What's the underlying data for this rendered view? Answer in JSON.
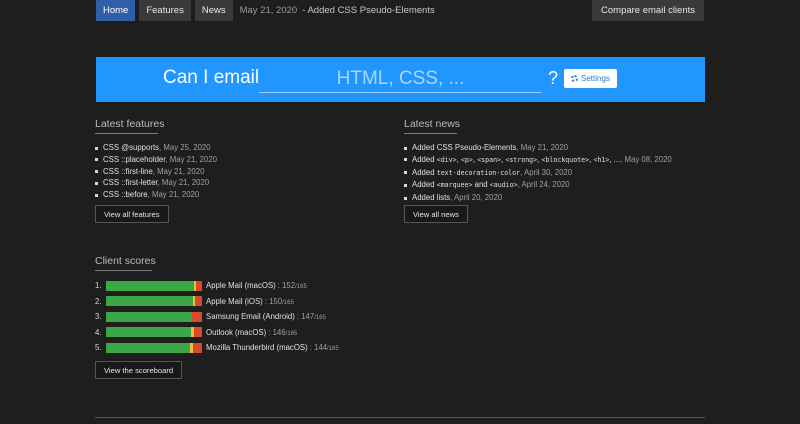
{
  "nav": {
    "home": "Home",
    "features": "Features",
    "news": "News",
    "latest_date": "May 21, 2020",
    "latest_text": "- Added CSS Pseudo-Elements",
    "compare": "Compare email clients"
  },
  "hero": {
    "label": "Can I email",
    "placeholder": "HTML, CSS, ...",
    "question": "?",
    "settings": "Settings"
  },
  "features": {
    "title": "Latest features",
    "items": [
      {
        "name": "CSS @supports",
        "date": ", May 25, 2020"
      },
      {
        "name": "CSS ::placeholder",
        "date": ", May 21, 2020"
      },
      {
        "name": "CSS ::first-line",
        "date": ", May 21, 2020"
      },
      {
        "name": "CSS ::first-letter",
        "date": ", May 21, 2020"
      },
      {
        "name": "CSS ::before",
        "date": ", May 21, 2020"
      }
    ],
    "button": "View all features"
  },
  "news": {
    "title": "Latest news",
    "items": [
      {
        "parts": [
          {
            "t": "Added CSS Pseudo-Elements"
          }
        ],
        "date": ", May 21, 2020"
      },
      {
        "parts": [
          {
            "t": "Added "
          },
          {
            "t": "<div>",
            "code": true
          },
          {
            "t": ", "
          },
          {
            "t": "<p>",
            "code": true
          },
          {
            "t": ", "
          },
          {
            "t": "<span>",
            "code": true
          },
          {
            "t": ", "
          },
          {
            "t": "<strong>",
            "code": true
          },
          {
            "t": ", "
          },
          {
            "t": "<blockquote>",
            "code": true
          },
          {
            "t": ", "
          },
          {
            "t": "<h1>",
            "code": true
          },
          {
            "t": ", ..."
          }
        ],
        "date": ", May 08, 2020"
      },
      {
        "parts": [
          {
            "t": "Added "
          },
          {
            "t": "text-decoration-color",
            "code": true
          }
        ],
        "date": ", April 30, 2020"
      },
      {
        "parts": [
          {
            "t": "Added "
          },
          {
            "t": "<marquee>",
            "code": true
          },
          {
            "t": " and "
          },
          {
            "t": "<audio>",
            "code": true
          }
        ],
        "date": ", April 24, 2020"
      },
      {
        "parts": [
          {
            "t": "Added lists"
          }
        ],
        "date": ", April 20, 2020"
      }
    ],
    "button": "View all news"
  },
  "scores": {
    "title": "Client scores",
    "max": 165,
    "rows": [
      {
        "rank": "1.",
        "name": "Apple Mail (macOS)",
        "score": 152,
        "supported": 152,
        "partial": 3,
        "unsupported": 10
      },
      {
        "rank": "2.",
        "name": "Apple Mail (iOS)",
        "score": 150,
        "supported": 150,
        "partial": 3,
        "unsupported": 12
      },
      {
        "rank": "3.",
        "name": "Samsung Email (Android)",
        "score": 147,
        "supported": 147,
        "partial": 0,
        "unsupported": 18
      },
      {
        "rank": "4.",
        "name": "Outlook (macOS)",
        "score": 146,
        "supported": 146,
        "partial": 5,
        "unsupported": 14
      },
      {
        "rank": "5.",
        "name": "Mozilla Thunderbird (macOS)",
        "score": 144,
        "supported": 144,
        "partial": 5,
        "unsupported": 16
      }
    ],
    "button": "View the scoreboard"
  },
  "colors": {
    "hero": "#2196ff",
    "supported": "#3aa846",
    "partial": "#e8c23a",
    "unsupported": "#d94a2b",
    "nav_active": "#2f5fa8"
  }
}
